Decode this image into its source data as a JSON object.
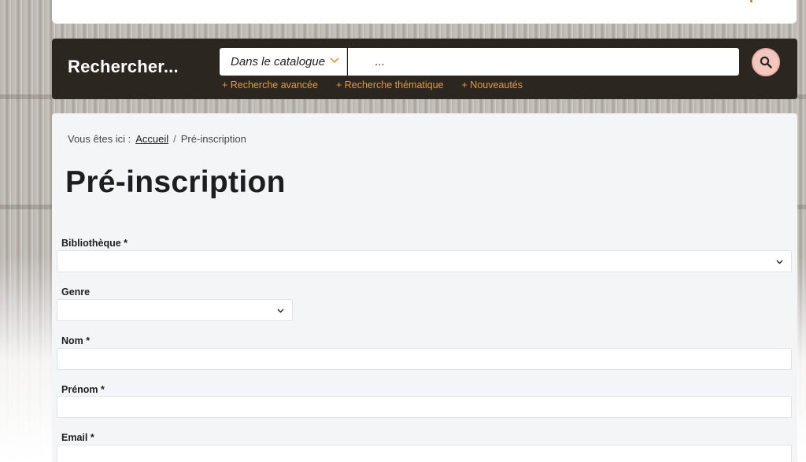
{
  "search": {
    "title": "Rechercher...",
    "scope_value": "Dans le catalogue",
    "query_placeholder": "...",
    "links": [
      "+ Recherche avancée",
      "+ Recherche thématique",
      "+ Nouveautés"
    ],
    "accent_color": "#e39a3c",
    "button_color": "#f3c7bf"
  },
  "breadcrumb": {
    "prefix": "Vous êtes ici :",
    "home": "Accueil",
    "separator": "/",
    "current": "Pré-inscription"
  },
  "page": {
    "title": "Pré-inscription"
  },
  "form": {
    "bibliotheque_label": "Bibliothèque *",
    "genre_label": "Genre",
    "nom_label": "Nom *",
    "prenom_label": "Prénom *",
    "email_label": "Email *"
  },
  "icons": {
    "search": "search-icon",
    "dropdown": "chevron-down-icon"
  }
}
